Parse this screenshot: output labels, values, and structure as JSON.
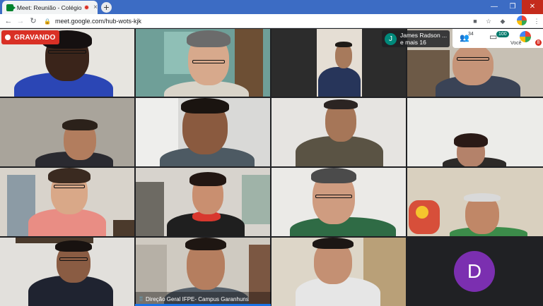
{
  "browser": {
    "tab_title": "Meet: Reunião - Colégio de",
    "tab_close": "×",
    "new_tab": "+",
    "url": "meet.google.com/hub-wots-kjk",
    "controls": {
      "minimize": "—",
      "maximize": "❐",
      "close": "✕"
    }
  },
  "meeting": {
    "recording_label": "GRAVANDO",
    "presenter": {
      "initial": "J",
      "line1": "James Radson ...",
      "line2": "e mais 16"
    },
    "participants_count": "34",
    "chat_count": "100",
    "self_label": "Você",
    "self_badge": "8",
    "avatar_initial": "D",
    "pinned_name": "Direção Geral IFPE- Campus Garanhuns"
  },
  "colors": {
    "recording": "#d93025",
    "avatar": "#7b2fb0",
    "chat_badge": "#00796b",
    "tab_strip": "#3c6cc4"
  }
}
